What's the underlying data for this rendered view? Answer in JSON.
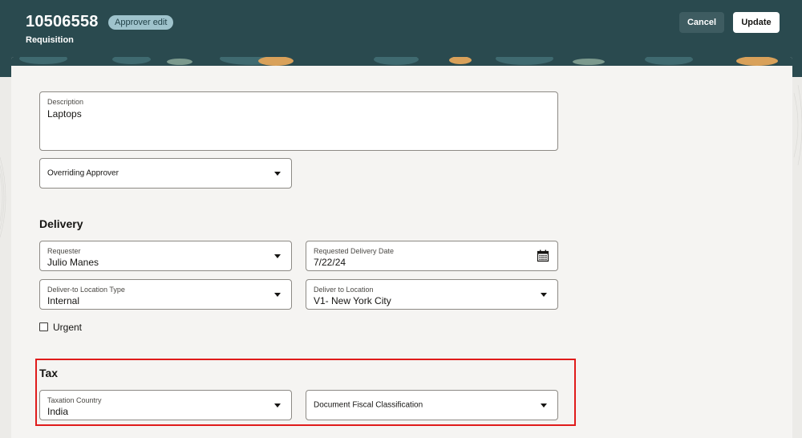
{
  "header": {
    "requisition_number": "10506558",
    "mode_badge": "Approver edit",
    "subtitle": "Requisition",
    "cancel_label": "Cancel",
    "update_label": "Update"
  },
  "colors": {
    "header_bg": "#2a4a4f",
    "badge_bg": "#9fc3cc",
    "highlight_border": "#e01b1b"
  },
  "form": {
    "description": {
      "label": "Description",
      "value": "Laptops"
    },
    "overriding_approver": {
      "placeholder": "Overriding Approver"
    },
    "delivery": {
      "title": "Delivery",
      "requester": {
        "label": "Requester",
        "value": "Julio Manes"
      },
      "requested_delivery_date": {
        "label": "Requested Delivery Date",
        "value": "7/22/24"
      },
      "deliver_to_location_type": {
        "label": "Deliver-to Location Type",
        "value": "Internal"
      },
      "deliver_to_location": {
        "label": "Deliver to Location",
        "value": "V1- New York City"
      },
      "urgent": {
        "label": "Urgent",
        "checked": false
      }
    },
    "tax": {
      "title": "Tax",
      "taxation_country": {
        "label": "Taxation Country",
        "value": "India"
      },
      "document_fiscal_classification": {
        "placeholder": "Document Fiscal Classification"
      }
    }
  },
  "icons": {
    "dropdown": "caret-down-icon",
    "calendar": "calendar-icon",
    "checkbox": "checkbox-icon"
  }
}
